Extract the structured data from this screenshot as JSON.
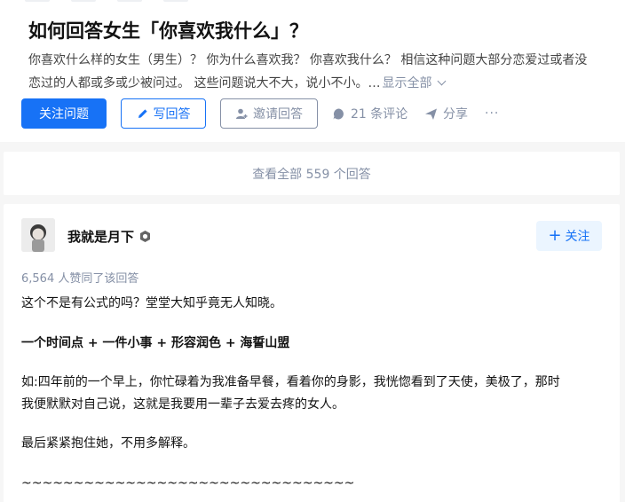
{
  "question": {
    "title": "如何回答女生「你喜欢我什么」？",
    "description_lines": [
      "你喜欢什么样的女生（男生）？ 你为什么喜欢我？ 你喜欢我什么？ 相信这种问题大部分恋爱过或者没",
      "恋过的人都或多或少被问过。 这些问题说大不大，说小不小。…"
    ],
    "show_all": "显示全部"
  },
  "actions": {
    "follow_label": "关注问题",
    "write_label": "写回答",
    "invite_label": "邀请回答",
    "comments_label": "21 条评论",
    "share_label": "分享",
    "more_label": "···"
  },
  "view_all": "查看全部 559 个回答",
  "answer": {
    "author": "我就是月下",
    "follow_label": "关注",
    "votes_text": "6,564 人赞同了该回答",
    "paragraphs": [
      "这个不是有公式的吗？堂堂大知乎竟无人知晓。",
      "一个时间点 + 一件小事 + 形容润色 + 海誓山盟",
      "如:四年前的一个早上，你忙碌着为我准备早餐，看着你的身影，我恍惚看到了天使，美极了，那时",
      "我便默默对自己说，这就是我要用一辈子去爱去疼的女人。",
      "最后紧紧抱住她，不用多解释。",
      "~~~~~~~~~~~~~~~~~~~~~~~~~~~~~~~~"
    ]
  },
  "colors": {
    "primary": "#1772f6",
    "muted": "#8590a6",
    "text": "#121212"
  }
}
